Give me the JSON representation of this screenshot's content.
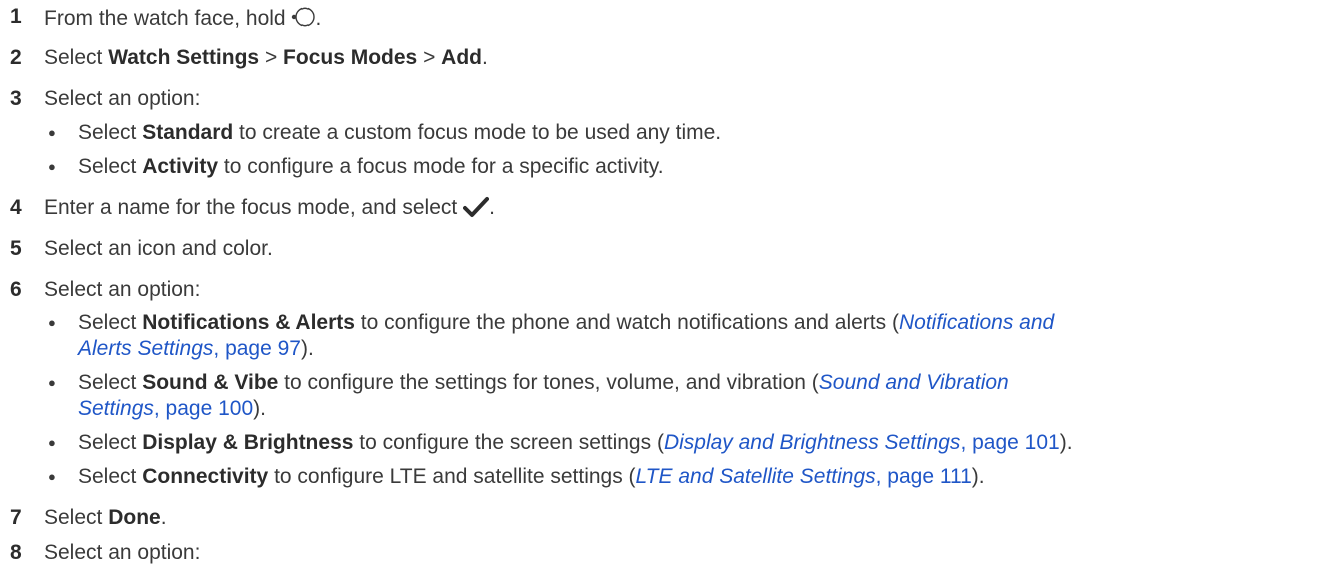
{
  "steps": [
    {
      "number": "1",
      "pre": "From the watch face, hold ",
      "icon": "watch-button-icon",
      "post": "."
    },
    {
      "number": "2",
      "pre": "Select ",
      "b1": "Watch Settings",
      "sep1": " > ",
      "b2": "Focus Modes",
      "sep2": " > ",
      "b3": "Add",
      "post": "."
    },
    {
      "number": "3",
      "text": "Select an option:",
      "bullets": [
        {
          "pre": "Select ",
          "bold": "Standard",
          "post": " to create a custom focus mode to be used any time."
        },
        {
          "pre": "Select ",
          "bold": "Activity",
          "post": " to configure a focus mode for a specific activity."
        }
      ]
    },
    {
      "number": "4",
      "pre": "Enter a name for the focus mode, and select ",
      "icon": "checkmark-icon",
      "post": "."
    },
    {
      "number": "5",
      "text": "Select an icon and color."
    },
    {
      "number": "6",
      "text": "Select an option:",
      "bullets": [
        {
          "pre": "Select ",
          "bold": "Notifications & Alerts",
          "post": " to configure the phone and watch notifications and alerts (",
          "link_italic_1": "Notifications and",
          "link_italic_2": "Alerts Settings",
          "link_page": ", page 97",
          "close": ")."
        },
        {
          "pre": "Select ",
          "bold": "Sound & Vibe",
          "post": " to configure the settings for tones, volume, and vibration (",
          "link_italic_1": "Sound and Vibration",
          "link_italic_2": "Settings",
          "link_page": ", page 100",
          "close": ")."
        },
        {
          "pre": "Select ",
          "bold": "Display & Brightness",
          "post": " to configure the screen settings (",
          "link_italic": "Display and Brightness Settings",
          "link_page": ", page 101",
          "close": ")."
        },
        {
          "pre": "Select ",
          "bold": "Connectivity",
          "post": " to configure LTE and satellite settings (",
          "link_italic": "LTE and Satellite Settings",
          "link_page": ", page 111",
          "close": ")."
        }
      ]
    },
    {
      "number": "7",
      "pre": "Select ",
      "bold": "Done",
      "post": "."
    },
    {
      "number": "8",
      "text": "Select an option:"
    }
  ],
  "bullet_glyph": "●",
  "colors": {
    "text": "#3a3a3a",
    "link": "#1f56c7"
  }
}
